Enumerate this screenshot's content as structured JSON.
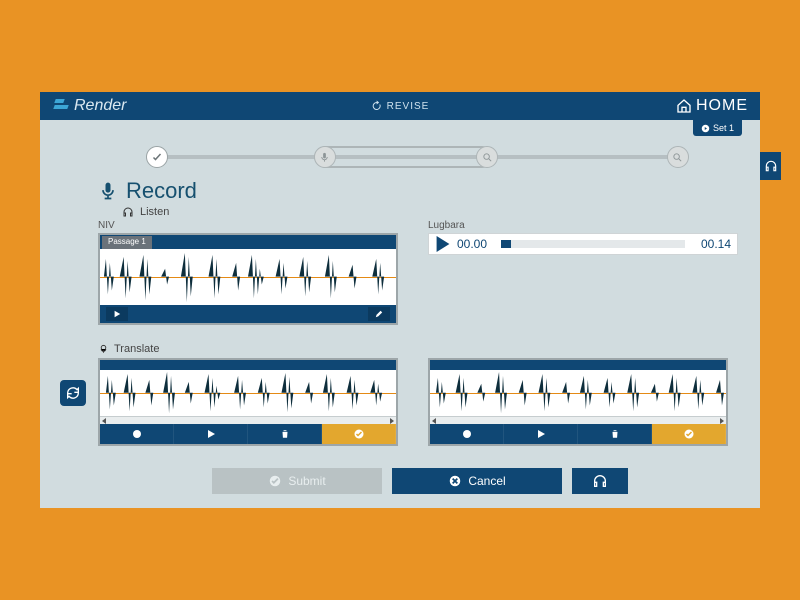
{
  "header": {
    "brand": "Render",
    "revise": "REVISE",
    "home": "HOME",
    "set_label": "Set 1"
  },
  "record": {
    "title": "Record",
    "listen_label": "Listen",
    "niv_label": "NIV",
    "passage_chip": "Passage 1",
    "lugbara_label": "Lugbara",
    "lugbara_current": "00.00",
    "lugbara_total": "00.14",
    "translate_label": "Translate"
  },
  "footer": {
    "submit": "Submit",
    "cancel": "Cancel"
  }
}
